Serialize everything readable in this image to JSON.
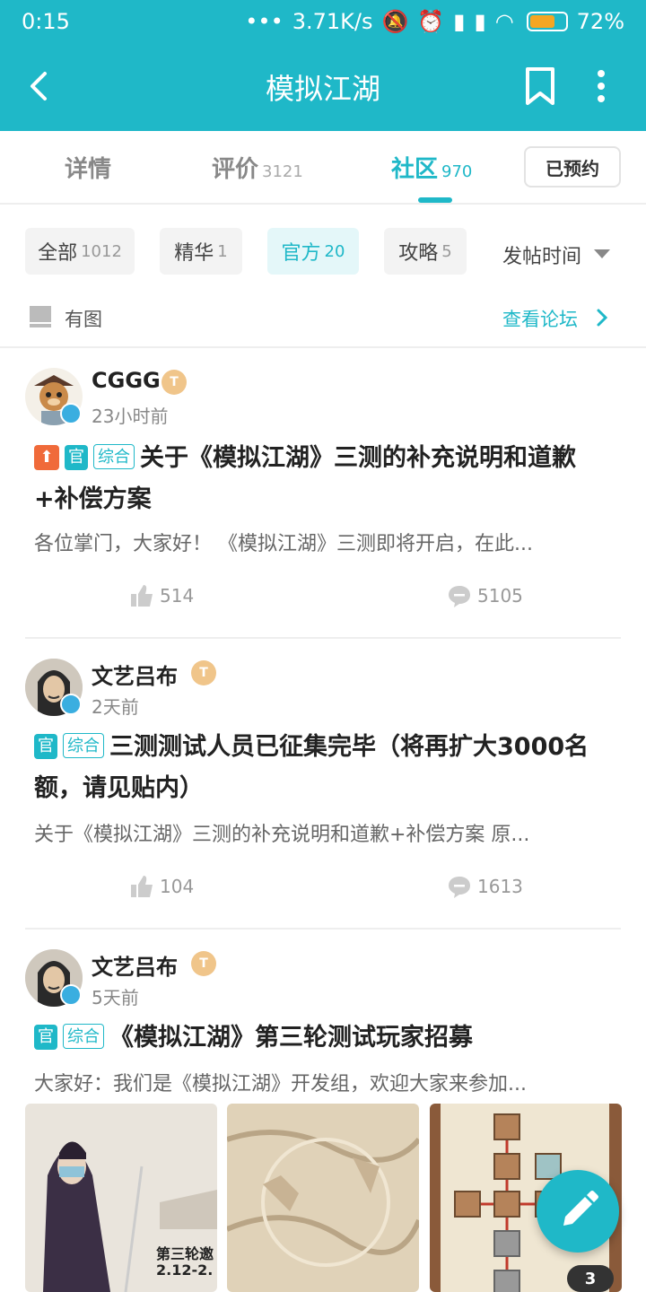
{
  "status": {
    "time": "0:15",
    "speed": "3.71K/s",
    "battery": "72%",
    "battery_level": 0.72
  },
  "appbar": {
    "title": "模拟江湖"
  },
  "tabs": [
    {
      "label": "详情",
      "count": ""
    },
    {
      "label": "评价",
      "count": "3121"
    },
    {
      "label": "社区",
      "count": "970",
      "active": true
    }
  ],
  "reserved_label": "已预约",
  "filters": [
    {
      "label": "全部",
      "count": "1012"
    },
    {
      "label": "精华",
      "count": "1"
    },
    {
      "label": "官方",
      "count": "20",
      "active": true
    },
    {
      "label": "攻略",
      "count": "5"
    }
  ],
  "sort_label": "发帖时间",
  "has_image_label": "有图",
  "forum_link": "查看论坛",
  "level_badge": "T",
  "posts": [
    {
      "username": "CGGG",
      "time": "23小时前",
      "badges": [
        "官",
        "综合"
      ],
      "pinned": true,
      "title": "关于《模拟江湖》三测的补充说明和道歉+补偿方案",
      "excerpt": "各位掌门，大家好！  《模拟江湖》三测即将开启，在此...",
      "likes": "514",
      "comments": "5105"
    },
    {
      "username": "文艺吕布",
      "time": "2天前",
      "badges": [
        "官",
        "综合"
      ],
      "title": "三测测试人员已征集完毕（将再扩大3000名额，请见贴内）",
      "excerpt": "关于《模拟江湖》三测的补充说明和道歉+补偿方案 原...",
      "likes": "104",
      "comments": "1613"
    },
    {
      "username": "文艺吕布",
      "time": "5天前",
      "badges": [
        "官",
        "综合"
      ],
      "title": "《模拟江湖》第三轮测试玩家招募",
      "excerpt": "大家好：我们是《模拟江湖》开发组，欢迎大家来参加...",
      "image_text": "第三轮邀",
      "image_date": "2.12-2.",
      "image_count": "3"
    }
  ]
}
